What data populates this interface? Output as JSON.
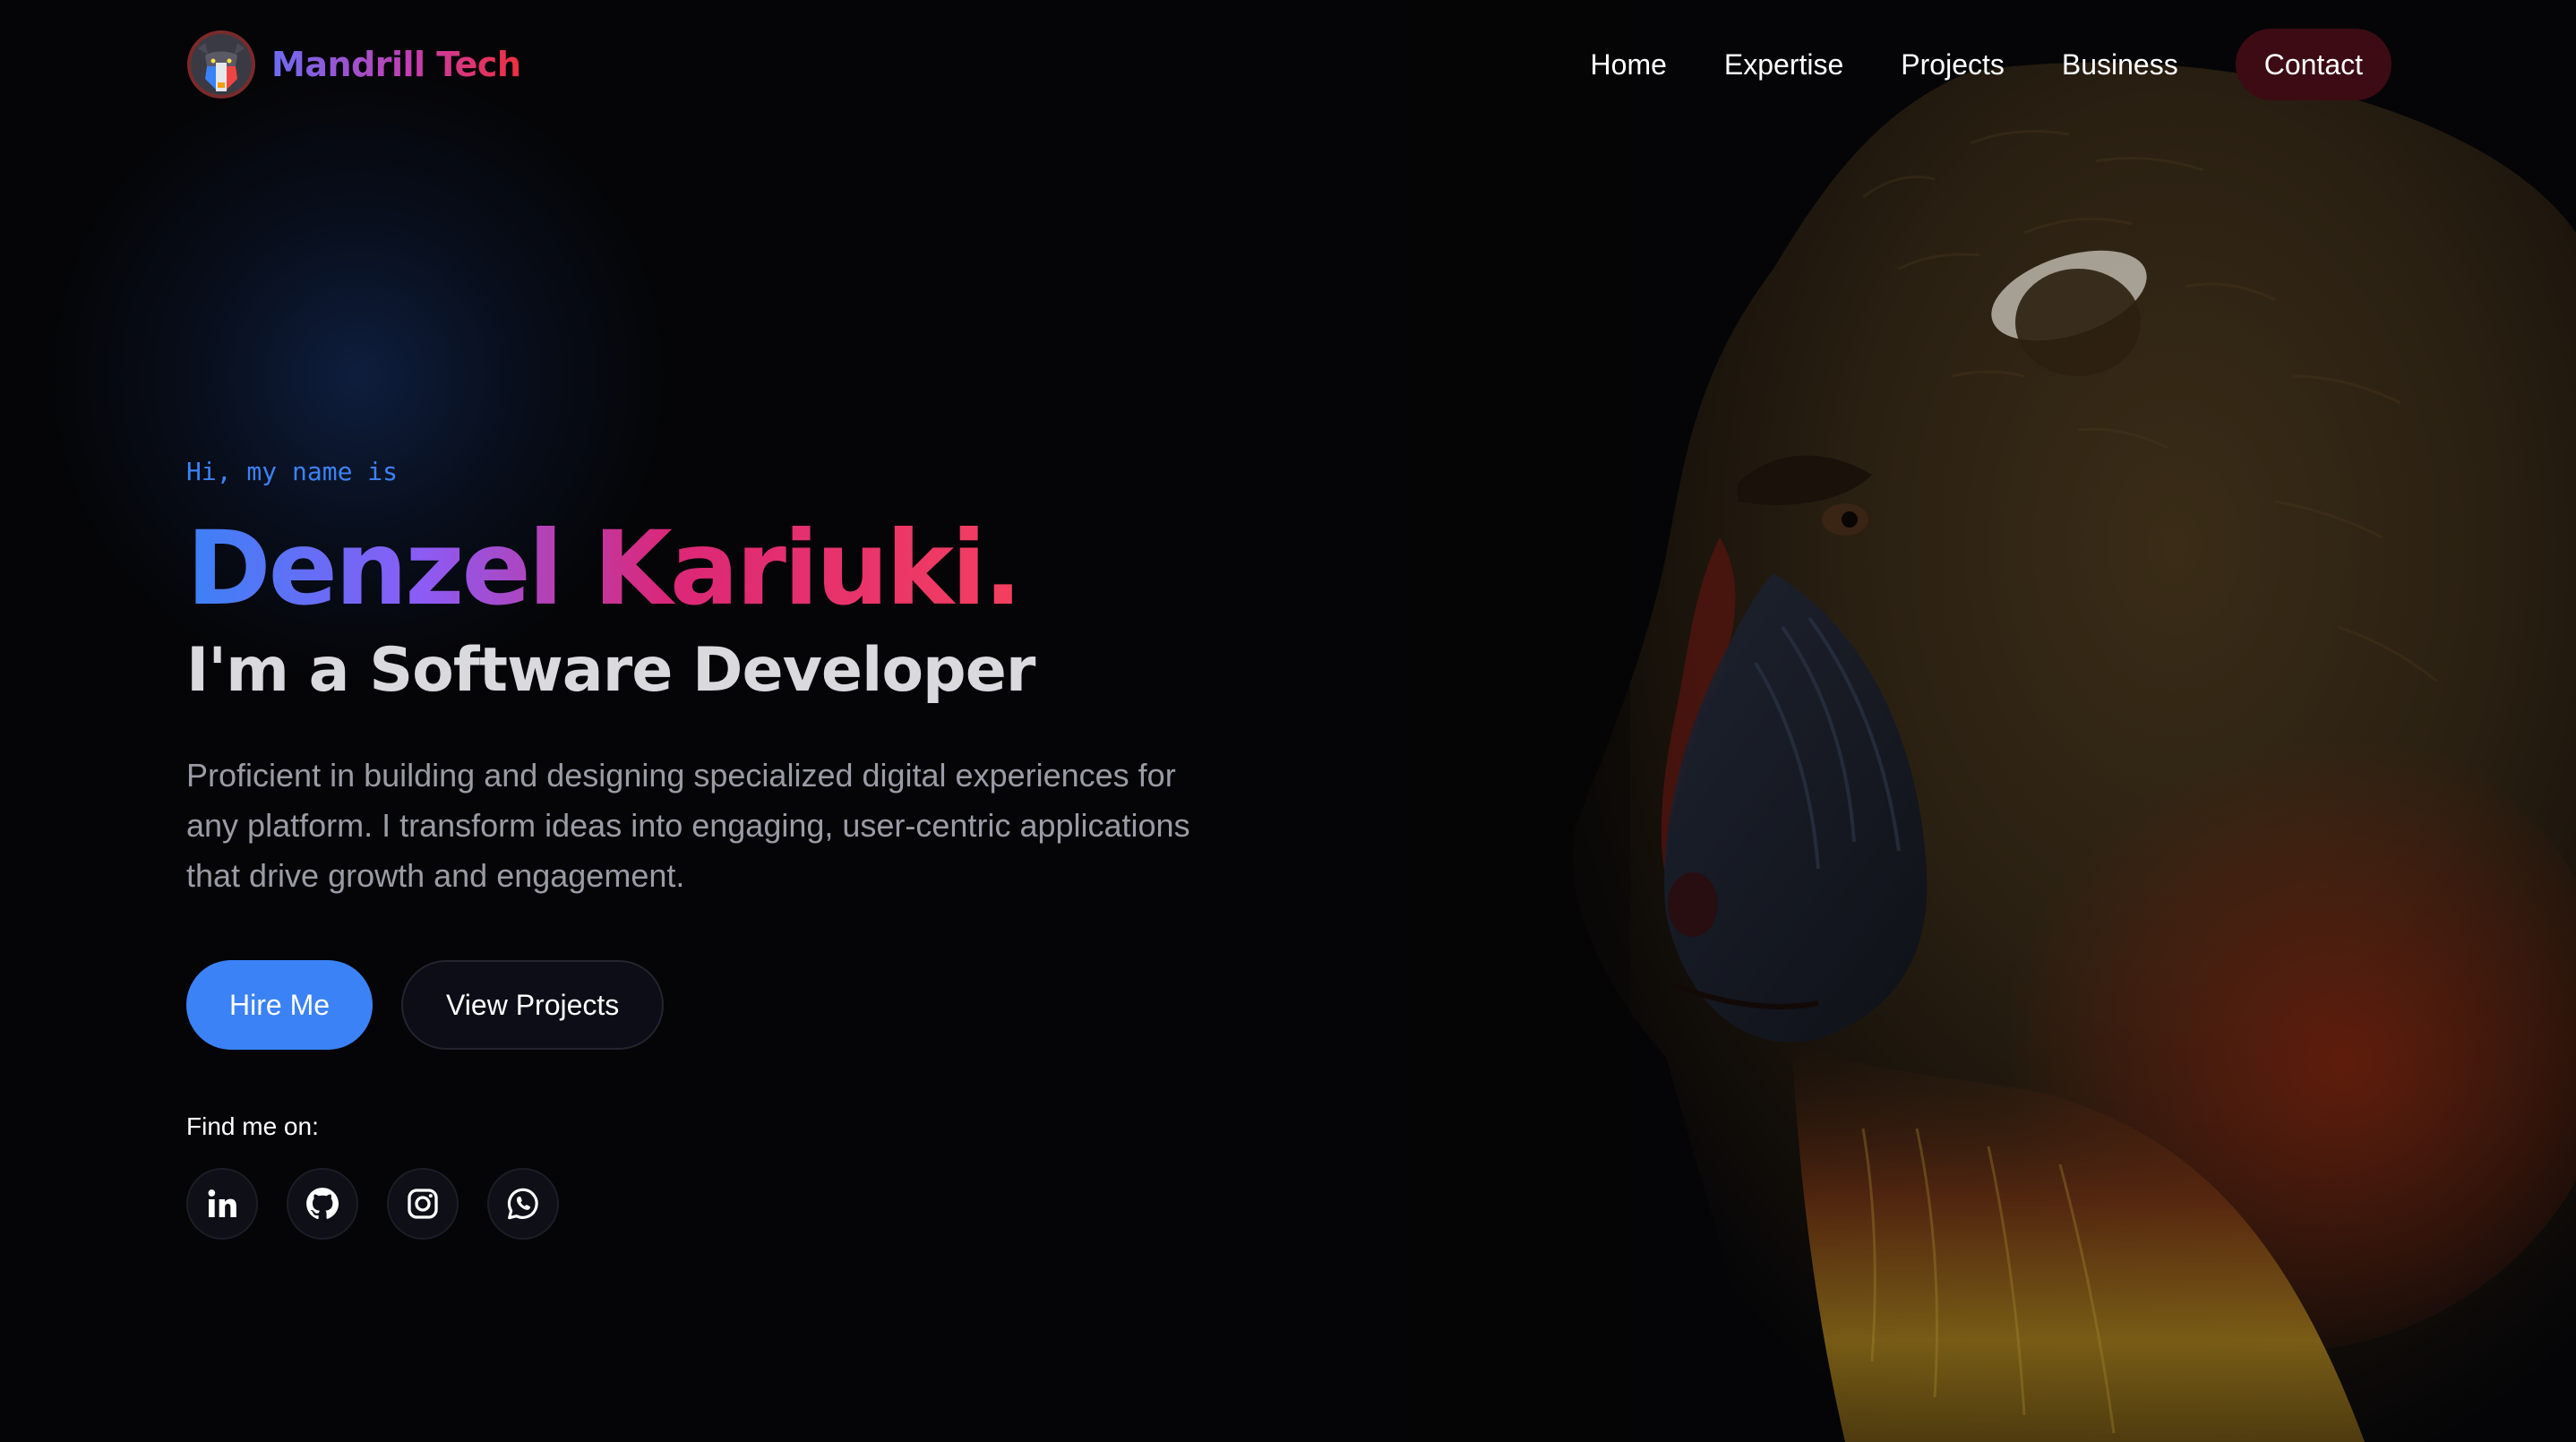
{
  "brand": {
    "name": "Mandrill Tech",
    "logo_icon": "mandrill-logo-icon"
  },
  "nav": {
    "items": [
      {
        "label": "Home"
      },
      {
        "label": "Expertise"
      },
      {
        "label": "Projects"
      },
      {
        "label": "Business"
      }
    ],
    "contact_label": "Contact"
  },
  "hero": {
    "greeting": "Hi, my name is",
    "name": "Denzel Kariuki.",
    "role": "I'm a Software Developer",
    "bio": "Proficient in building and designing specialized digital experiences for any platform. I transform ideas into engaging, user-centric applications that drive growth and engagement.",
    "primary_cta": "Hire Me",
    "secondary_cta": "View Projects"
  },
  "socials": {
    "label": "Find me on:",
    "items": [
      {
        "icon": "linkedin-icon"
      },
      {
        "icon": "github-icon"
      },
      {
        "icon": "instagram-icon"
      },
      {
        "icon": "whatsapp-icon"
      }
    ]
  },
  "colors": {
    "accent": "#3b82f6",
    "background": "#050507",
    "contact_button": "#3d0b14",
    "name_gradient": [
      "#3b82f6",
      "#8b5cf6",
      "#db2777",
      "#f43f5e"
    ]
  }
}
